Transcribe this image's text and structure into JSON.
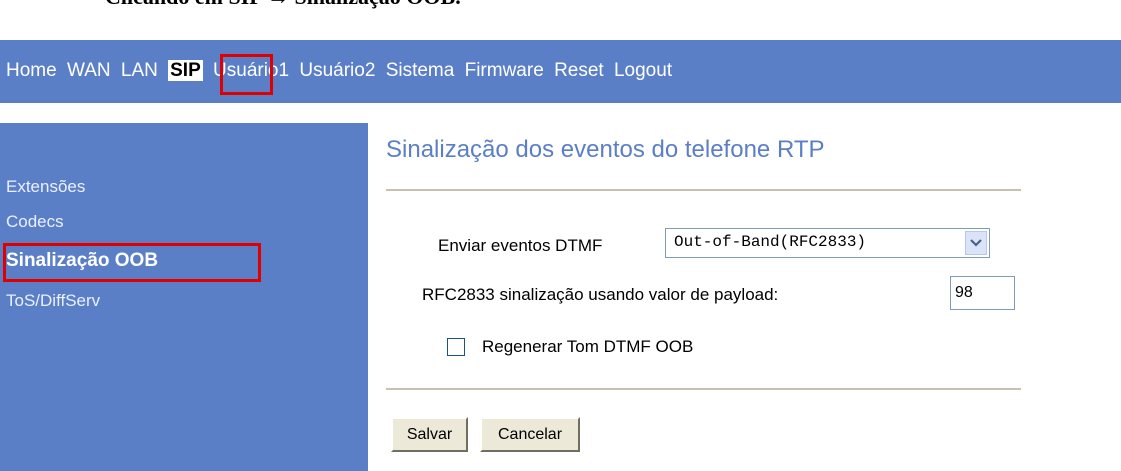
{
  "caption": "Clicando em SIP → Sinalização OOB.",
  "nav": {
    "items": [
      "Home",
      "WAN",
      "LAN",
      "SIP",
      "Usuário1",
      "Usuário2",
      "Sistema",
      "Firmware",
      "Reset",
      "Logout"
    ],
    "active": "SIP"
  },
  "sidebar": {
    "items": [
      "Extensões",
      "Codecs",
      "Sinalização OOB",
      "ToS/DiffServ"
    ],
    "active": "Sinalização OOB"
  },
  "main": {
    "title": "Sinalização dos eventos do telefone RTP",
    "dtmf": {
      "label": "Enviar eventos DTMF",
      "selected": "Out-of-Band(RFC2833)"
    },
    "payload": {
      "label": "RFC2833 sinalização usando valor de payload:",
      "value": "98"
    },
    "regen": {
      "label": "Regenerar Tom DTMF OOB",
      "checked": false
    },
    "buttons": {
      "save": "Salvar",
      "cancel": "Cancelar"
    }
  },
  "colors": {
    "bar": "#5b7fc7",
    "highlight": "#e00000"
  }
}
